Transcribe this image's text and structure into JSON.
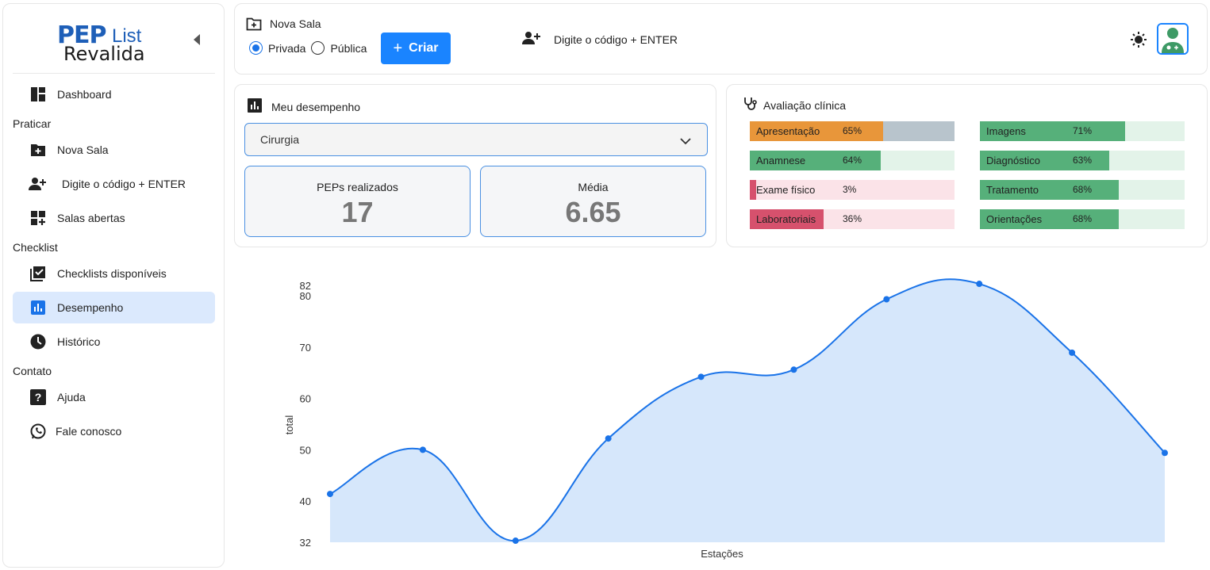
{
  "sidebar": {
    "logo": {
      "pep": "PEP",
      "list": "List",
      "revalida": "Revalida"
    },
    "items": {
      "dashboard": "Dashboard",
      "nova_sala": "Nova Sala",
      "codigo": "Digite o código + ENTER",
      "salas_abertas": "Salas abertas",
      "checklists": "Checklists disponíveis",
      "desempenho": "Desempenho",
      "historico": "Histórico",
      "ajuda": "Ajuda",
      "fale": "Fale conosco"
    },
    "sections": {
      "praticar": "Praticar",
      "checklist": "Checklist",
      "contato": "Contato"
    }
  },
  "topbar": {
    "nova_sala": "Nova Sala",
    "privada": "Privada",
    "publica": "Pública",
    "criar": "Criar",
    "codigo": "Digite o código + ENTER"
  },
  "performance": {
    "title": "Meu desempenho",
    "select_value": "Cirurgia",
    "peps_label": "PEPs realizados",
    "peps_value": "17",
    "media_label": "Média",
    "media_value": "6.65"
  },
  "evaluation": {
    "title": "Avaliação clínica",
    "bars": [
      {
        "label": "Apresentação",
        "pct": 65,
        "text": "65%",
        "color": "#e8963a",
        "track": "#b8c4cc"
      },
      {
        "label": "Anamnese",
        "pct": 64,
        "text": "64%",
        "color": "#56b07a",
        "track": "#e3f3e9"
      },
      {
        "label": "Exame físico",
        "pct": 3,
        "text": "3%",
        "color": "#d6516d",
        "track": "#fbe3e8"
      },
      {
        "label": "Laboratoriais",
        "pct": 36,
        "text": "36%",
        "color": "#d6516d",
        "track": "#fbe3e8"
      },
      {
        "label": "Imagens",
        "pct": 71,
        "text": "71%",
        "color": "#56b07a",
        "track": "#e3f3e9"
      },
      {
        "label": "Diagnóstico",
        "pct": 63,
        "text": "63%",
        "color": "#56b07a",
        "track": "#e3f3e9"
      },
      {
        "label": "Tratamento",
        "pct": 68,
        "text": "68%",
        "color": "#56b07a",
        "track": "#e3f3e9"
      },
      {
        "label": "Orientações",
        "pct": 68,
        "text": "68%",
        "color": "#56b07a",
        "track": "#e3f3e9"
      }
    ]
  },
  "chart_data": {
    "type": "area",
    "values": [
      41.4,
      50,
      32.3,
      52.2,
      64.2,
      65.6,
      79.3,
      82.3,
      68.9,
      49.4
    ],
    "ylabel": "total",
    "xlabel": "Estações",
    "ylim": [
      32,
      82
    ],
    "yticks": [
      32,
      40,
      50,
      60,
      70,
      80,
      82
    ],
    "line_color": "#1a73e8",
    "fill_color": "#d6e7fb",
    "grid": false
  }
}
